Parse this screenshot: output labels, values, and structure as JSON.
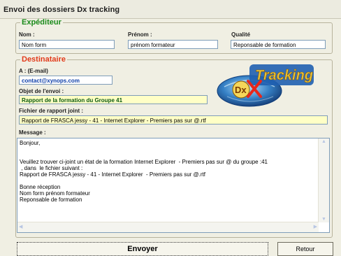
{
  "window": {
    "title": "Envoi des dossiers Dx tracking"
  },
  "sender": {
    "legend": "Expéditeur",
    "name_label": "Nom :",
    "name_value": "Nom form",
    "firstname_label": "Prénom :",
    "firstname_value": "prénom formateur",
    "quality_label": "Qualité",
    "quality_value": "Reponsable de formation"
  },
  "recipient": {
    "legend": "Destinataire",
    "email_label": "A : (E-mail)",
    "email_value": "contact@xynops.com",
    "subject_label": "Objet de l'envoi :",
    "subject_value": "Rapport de la formation du Groupe 41",
    "file_label": "Fichier de rapport joint :",
    "file_value": "Rapport de FRASCA jessy - 41 - Internet Explorer  - Premiers pas sur @.rtf",
    "message_label": "Message :",
    "message_lines": [
      "Bonjour,",
      "",
      "",
      "Veuillez trouver ci-joint un état de la formation Internet Explorer  - Premiers pas sur @ du groupe :41",
      " , dans  le fichier suivant :",
      "Rapport de FRASCA jessy - 41 - Internet Explorer  - Premiers pas sur @.rtf",
      "",
      "Bonne réception",
      "Nom form prénom formateur",
      "Reponsable de formation"
    ]
  },
  "logo": {
    "text": "Tracking",
    "badge": "Dx"
  },
  "buttons": {
    "send": "Envoyer",
    "back": "Retour"
  },
  "colors": {
    "legend_sender": "#1a8a1a",
    "legend_recipient": "#e23a1a",
    "email_text": "#0c3da8",
    "subject_text": "#0b5a10",
    "field_highlight": "#ffffc6"
  }
}
